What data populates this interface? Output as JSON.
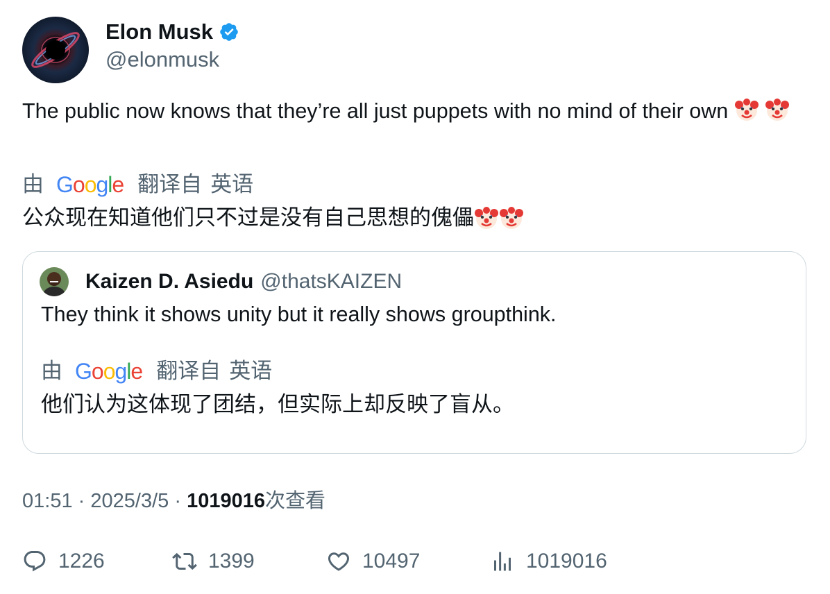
{
  "author": {
    "display_name": "Elon Musk",
    "handle": "@elonmusk",
    "verified": true,
    "avatar_icon": "black-hole-avatar",
    "verified_color": "#1d9bf0"
  },
  "tweet": {
    "text": "The public now knows that they’re all just puppets with no mind of their own",
    "emoji": [
      "clown-face",
      "clown-face"
    ],
    "translation": {
      "by_label": "由",
      "provider": "Google",
      "from_label": "翻译自",
      "language": "英语",
      "text": "公众现在知道他们只不过是没有自己思想的傀儡"
    }
  },
  "quote": {
    "display_name": "Kaizen D. Asiedu",
    "handle": "@thatsKAIZEN",
    "text": "They think it shows unity but it really shows groupthink.",
    "translation": {
      "by_label": "由",
      "provider": "Google",
      "from_label": "翻译自",
      "language": "英语",
      "text": "他们认为这体现了团结，但实际上却反映了盲从。"
    }
  },
  "meta": {
    "time": "01:51",
    "date": "2025/3/5",
    "separator": "·",
    "views_count": "1019016",
    "views_label": "次查看"
  },
  "actions": {
    "replies": "1226",
    "retweets": "1399",
    "likes": "10497",
    "views": "1019016"
  },
  "colors": {
    "text": "#0f1419",
    "secondary": "#536471",
    "border": "#cfd9de"
  }
}
